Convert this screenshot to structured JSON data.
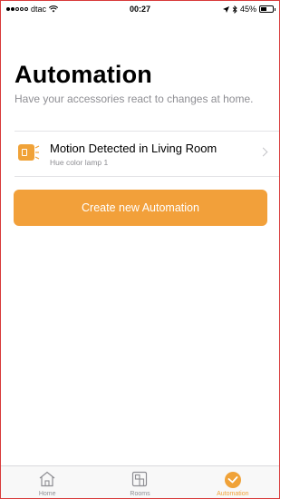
{
  "status_bar": {
    "carrier": "dtac",
    "time": "00:27",
    "battery_percent": "45%",
    "battery_level": 0.45
  },
  "header": {
    "title": "Automation",
    "subtitle": "Have your accessories react to changes at home."
  },
  "automations": [
    {
      "title": "Motion Detected in Living Room",
      "subtitle": "Hue color lamp 1",
      "icon": "lamp-icon"
    }
  ],
  "create_button_label": "Create new Automation",
  "tab_bar": {
    "tabs": [
      {
        "label": "Home",
        "icon": "house-icon",
        "active": false
      },
      {
        "label": "Rooms",
        "icon": "rooms-icon",
        "active": false
      },
      {
        "label": "Automation",
        "icon": "automation-icon",
        "active": true
      }
    ]
  },
  "colors": {
    "accent": "#f2a03a",
    "secondary_text": "#8e8e93"
  }
}
